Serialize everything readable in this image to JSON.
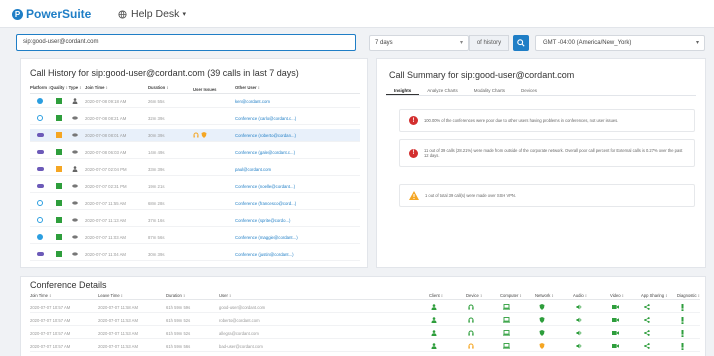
{
  "app": {
    "name": "PowerSuite",
    "logo_letter": "P",
    "module": "Help Desk",
    "accent": "#1f7ec6"
  },
  "search": {
    "value": "sip:good-user@cordant.com"
  },
  "filters": {
    "range": "7 days",
    "history_label": "of history",
    "timezone": "GMT -04:00 (America/New_York)"
  },
  "history": {
    "title": "Call History for sip:good-user@cordant.com (39 calls in last 7 days)",
    "columns": [
      "Platform ↕",
      "Quality ↕",
      "Type ↕",
      "Join Time ↕",
      "Duration ↕",
      "User Issues",
      "Other User ↕"
    ],
    "rows": [
      {
        "platform": "skype",
        "quality": "green",
        "type": "person",
        "join": "2020-07-08 09:18 AM",
        "duration": "26m 55s",
        "user": "ken@cordant.com"
      },
      {
        "platform": "circle",
        "quality": "green",
        "type": "conf",
        "join": "2020-07-08 08:21 AM",
        "duration": "32m 39s",
        "user": "Conference (carlo@cordant.c...)"
      },
      {
        "platform": "phone",
        "quality": "orange",
        "type": "conf",
        "join": "2020-07-08 08:01 AM",
        "duration": "30m 39s",
        "issues": true,
        "selected": true,
        "user": "Conference (roberto@cordan...)"
      },
      {
        "platform": "phone",
        "quality": "green",
        "type": "conf",
        "join": "2020-07-08 06:03 AM",
        "duration": "14m 49s",
        "user": "Conference (gale@cordant.c...)"
      },
      {
        "platform": "phone",
        "quality": "orange",
        "type": "person",
        "join": "2020-07-07 02:04 PM",
        "duration": "33m 39s",
        "user": "paul@cordant.com"
      },
      {
        "platform": "phone",
        "quality": "green",
        "type": "conf",
        "join": "2020-07-07 02:31 PM",
        "duration": "19m 21s",
        "user": "Conference (noelle@cordant...)"
      },
      {
        "platform": "circle",
        "quality": "green",
        "type": "conf",
        "join": "2020-07-07 11:55 AM",
        "duration": "68m 28s",
        "user": "Conference (francesco@cord...)"
      },
      {
        "platform": "circle",
        "quality": "green",
        "type": "conf",
        "join": "2020-07-07 11:13 AM",
        "duration": "37m 16s",
        "user": "Conference (sprite@cordo...)"
      },
      {
        "platform": "skype",
        "quality": "green",
        "type": "conf",
        "join": "2020-07-07 11:03 AM",
        "duration": "87m 56s",
        "user": "Conference (maggie@cordant...)"
      },
      {
        "platform": "phone",
        "quality": "green",
        "type": "conf",
        "join": "2020-07-07 11:04 AM",
        "duration": "30m 39s",
        "user": "Conference (justin@cordant...)"
      }
    ]
  },
  "summary": {
    "title": "Call Summary for sip:good-user@cordant.com",
    "tabs": [
      "Insights",
      "Analyze Charts",
      "Modality Charts",
      "Devices"
    ],
    "alerts": [
      {
        "level": "error",
        "text": "100.00% of the conferences were poor due to other users having problems in conferences, not user issues."
      },
      {
        "level": "error",
        "text": "11 out of 39 calls (28.21%) were made from outside of the corporate network. Overall poor call percent for External calls is 0.27% over the past 12 days."
      },
      {
        "level": "warning",
        "text": "1 out of total 39 call(s) were made over SSH VPN."
      }
    ]
  },
  "conference": {
    "title": "Conference Details",
    "columns": [
      "Join Time ↕",
      "Leave Time ↕",
      "Duration ↕",
      "User ↕",
      "Client ↕",
      "Device ↕",
      "Computer ↕",
      "Network ↕",
      "Audio ↕",
      "Video ↕",
      "App Sharing ↕",
      "Diagnostic ↕"
    ],
    "rows": [
      {
        "join": "2020-07-07 10:57 AM",
        "leave": "2020-07-07 11:58 AM",
        "duration": "61h 59m 59s",
        "user": "good-user@cordant.com",
        "warn": false
      },
      {
        "join": "2020-07-07 10:57 AM",
        "leave": "2020-07-07 11:53 AM",
        "duration": "61h 59m 52s",
        "user": "roberto@cordant.com",
        "warn": false
      },
      {
        "join": "2020-07-07 10:57 AM",
        "leave": "2020-07-07 11:53 AM",
        "duration": "61h 59m 52s",
        "user": "allegra@cordant.com",
        "warn": false
      },
      {
        "join": "2020-07-07 10:57 AM",
        "leave": "2020-07-07 11:53 AM",
        "duration": "61h 59m 56s",
        "user": "bad-user@cordant.com",
        "warn": true
      }
    ]
  },
  "colors": {
    "green": "#2e9e3c",
    "orange": "#f5a623",
    "red": "#d32f2f",
    "phone": "#6c5ab8",
    "skype": "#2b9ee0"
  }
}
